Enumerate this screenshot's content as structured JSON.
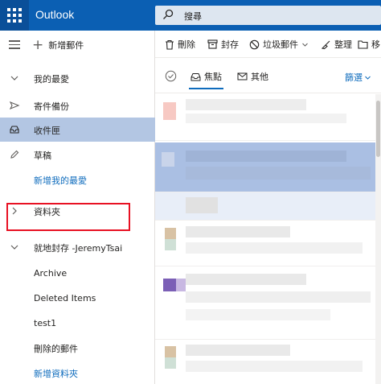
{
  "app": {
    "brand": "Outlook",
    "search_placeholder": "搜尋"
  },
  "leftnav": {
    "new_mail": "新增郵件",
    "favorites_header": "我的最愛",
    "sent": "寄件備份",
    "inbox": "收件匣",
    "drafts": "草稿",
    "add_favorite": "新增我的最愛",
    "folders": "資料夾",
    "archive_mailbox": "就地封存 -JeremyTsai",
    "archive": "Archive",
    "deleted_items": "Deleted Items",
    "test1": "test1",
    "deleted_mail": "刪除的郵件",
    "new_folder": "新增資料夾"
  },
  "toolbar": {
    "delete": "刪除",
    "archive": "封存",
    "junk": "垃圾郵件",
    "sweep": "整理",
    "move": "移"
  },
  "pivots": {
    "focused": "焦點",
    "other": "其他",
    "filter": "篩選"
  },
  "colors": {
    "topbar": "#0b5fb3",
    "accent": "#0f6cbd",
    "selected_nav": "#b3c6e3",
    "highlight_box": "#e81123"
  }
}
